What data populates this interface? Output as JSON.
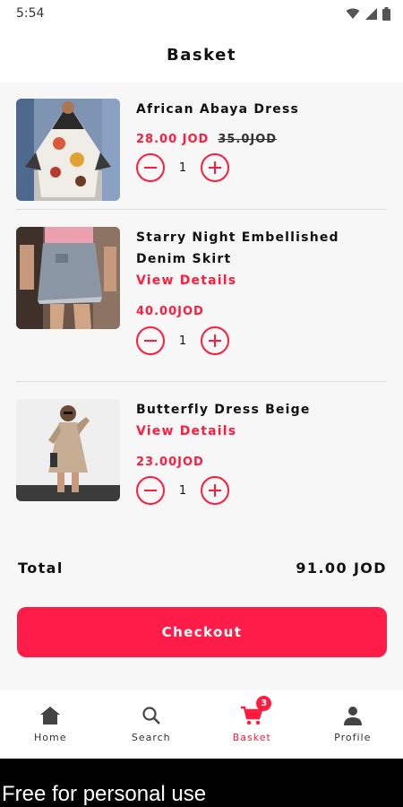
{
  "status_bar": {
    "time": "5:54"
  },
  "header": {
    "title": "Basket"
  },
  "items": [
    {
      "name": "African Abaya Dress",
      "price": "28.00 JOD",
      "old_price": "35.0JOD",
      "quantity": "1"
    },
    {
      "name": "Starry Night Embellished Denim Skirt",
      "details_label": "View Details",
      "price": "40.00JOD",
      "quantity": "1"
    },
    {
      "name": "Butterfly Dress Beige",
      "details_label": "View Details",
      "price": "23.00JOD",
      "quantity": "1"
    }
  ],
  "summary": {
    "total_label": "Total",
    "total_value": "91.00 JOD"
  },
  "checkout_label": "Checkout",
  "nav": {
    "items": [
      {
        "label": "Home",
        "icon": "home-icon"
      },
      {
        "label": "Search",
        "icon": "search-icon"
      },
      {
        "label": "Basket",
        "icon": "cart-icon",
        "badge": "3",
        "active": true
      },
      {
        "label": "Profile",
        "icon": "person-icon"
      }
    ]
  },
  "watermark": "Free for personal use",
  "colors": {
    "accent": "#ff1c3c",
    "button": "#ff1c48"
  }
}
